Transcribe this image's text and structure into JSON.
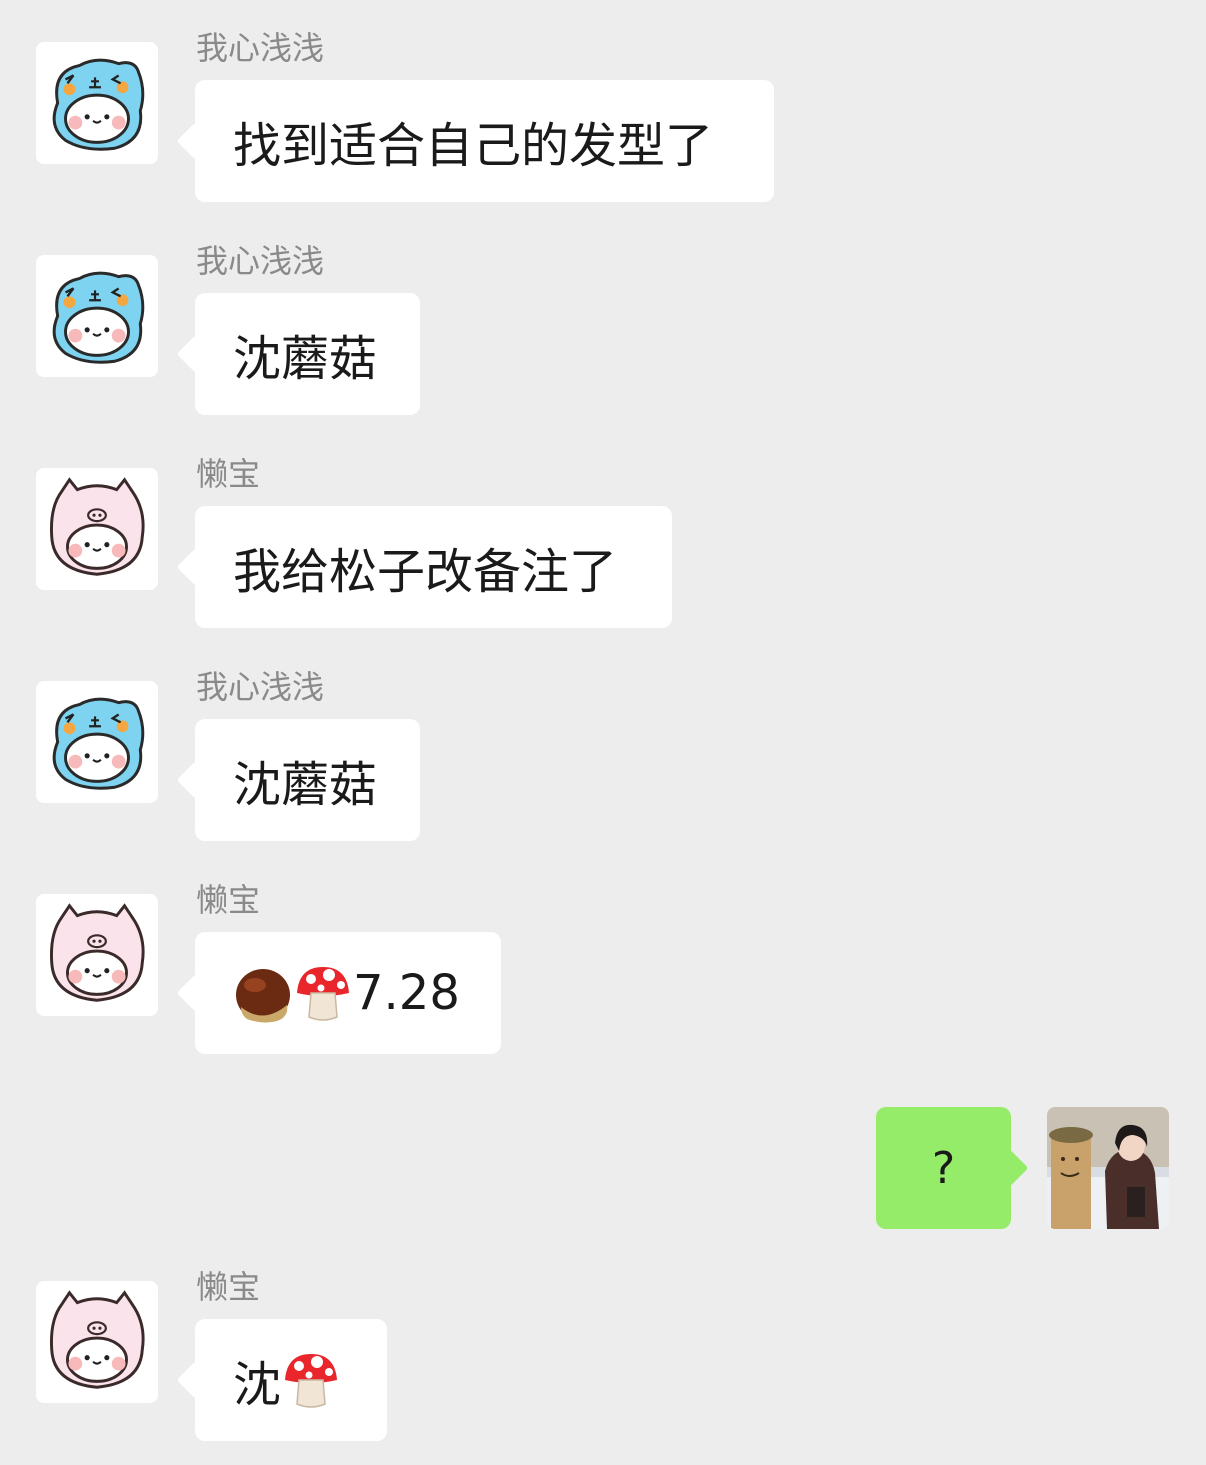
{
  "messages": [
    {
      "sender": "我心浅浅",
      "avatar": "cat-hood-avatar",
      "text": "找到适合自己的发型了"
    },
    {
      "sender": "我心浅浅",
      "avatar": "cat-hood-avatar",
      "text": "沈蘑菇"
    },
    {
      "sender": "懒宝",
      "avatar": "pig-hood-avatar",
      "text": "我给松子改备注了"
    },
    {
      "sender": "我心浅浅",
      "avatar": "cat-hood-avatar",
      "text": "沈蘑菇"
    },
    {
      "sender": "懒宝",
      "avatar": "pig-hood-avatar",
      "text": "7.28",
      "emojis": [
        "chestnut-emoji",
        "mushroom-emoji"
      ]
    },
    {
      "sender": "self",
      "avatar": "photo-avatar",
      "text": "?"
    },
    {
      "sender": "懒宝",
      "avatar": "pig-hood-avatar",
      "text": "沈",
      "emojis": [
        "mushroom-emoji"
      ]
    }
  ],
  "colors": {
    "background": "#ededed",
    "incoming_bubble": "#ffffff",
    "outgoing_bubble": "#95ec69",
    "sender_name": "#8a8a8a"
  }
}
